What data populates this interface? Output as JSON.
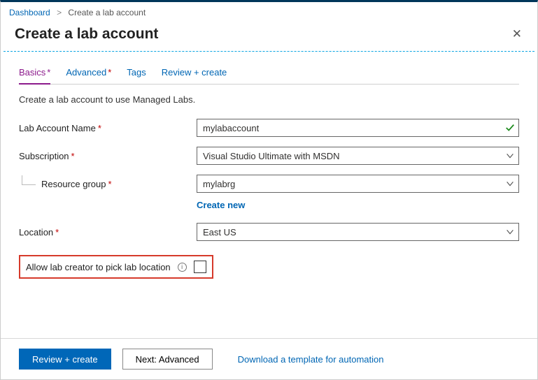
{
  "breadcrumb": {
    "root": "Dashboard",
    "current": "Create a lab account"
  },
  "title": "Create a lab account",
  "tabs": {
    "basics": "Basics",
    "advanced": "Advanced",
    "tags": "Tags",
    "review": "Review + create"
  },
  "intro": "Create a lab account to use Managed Labs.",
  "labels": {
    "labAccountName": "Lab Account Name",
    "subscription": "Subscription",
    "resourceGroup": "Resource group",
    "location": "Location",
    "allowCreatorPick": "Allow lab creator to pick lab location"
  },
  "values": {
    "labAccountName": "mylabaccount",
    "subscription": "Visual Studio Ultimate with MSDN",
    "resourceGroup": "mylabrg",
    "location": "East US"
  },
  "links": {
    "createNew": "Create new",
    "downloadTemplate": "Download a template for automation"
  },
  "buttons": {
    "reviewCreate": "Review + create",
    "nextAdvanced": "Next: Advanced"
  }
}
